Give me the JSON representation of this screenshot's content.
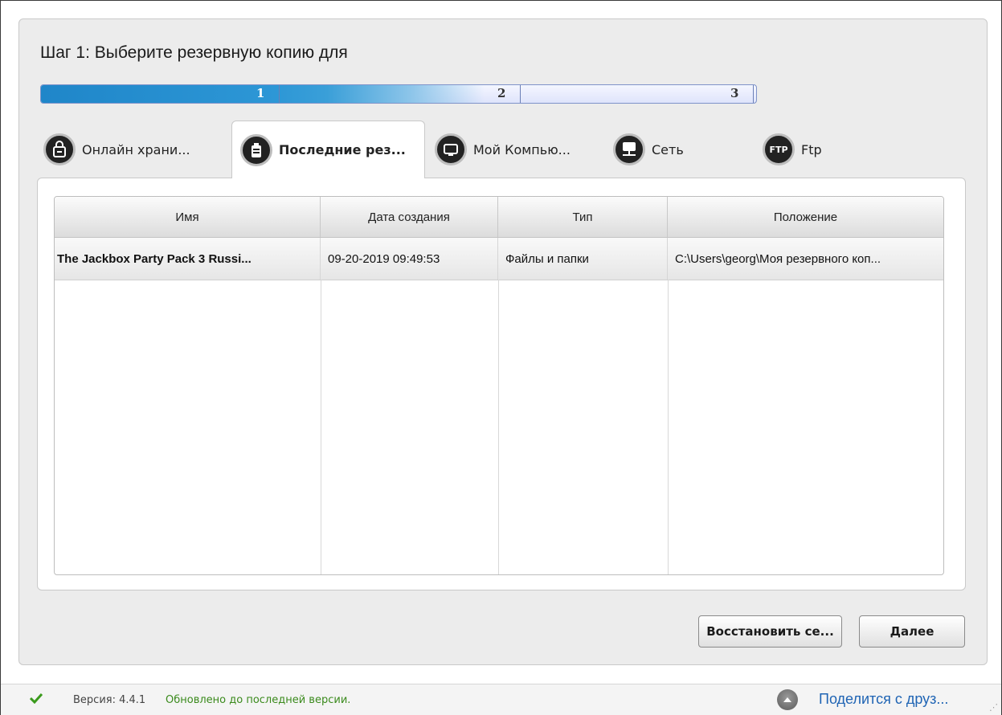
{
  "step": {
    "title": "Шаг 1: Выберите резервную копию для"
  },
  "progress": {
    "steps": [
      "1",
      "2",
      "3"
    ],
    "current": 1,
    "fill_fraction": 0.45
  },
  "tabs": [
    {
      "label": "Онлайн храни...",
      "icon": "lock-icon",
      "active": false
    },
    {
      "label": "Последние рез...",
      "icon": "backup-icon",
      "active": true
    },
    {
      "label": "Мой Компью...",
      "icon": "monitor-icon",
      "active": false
    },
    {
      "label": "Сеть",
      "icon": "network-icon",
      "active": false
    },
    {
      "label": "Ftp",
      "icon": "ftp-icon",
      "active": false
    }
  ],
  "ftp_badge": "FTP",
  "table": {
    "columns": [
      "Имя",
      "Дата создания",
      "Тип",
      "Положение"
    ],
    "rows": [
      {
        "name": "The Jackbox Party Pack 3 Russi...",
        "date": "09-20-2019 09:49:53",
        "type": "Файлы и папки",
        "location": "C:\\Users\\georg\\Моя резервного коп..."
      }
    ]
  },
  "buttons": {
    "restore": "Восстановить се...",
    "next": "Далее"
  },
  "status": {
    "version": "Версия:  4.4.1",
    "update": "Обновлено до последней версии.",
    "share": "Поделится с друз..."
  },
  "colors": {
    "progress": "#1f86c9",
    "update_text": "#3a8a1c",
    "link": "#1f64b4"
  }
}
